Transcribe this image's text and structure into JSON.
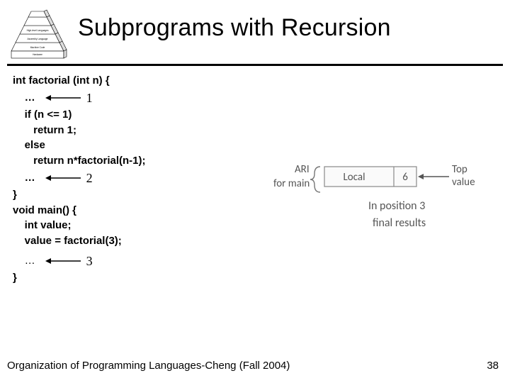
{
  "slide": {
    "title": "Subprograms with Recursion",
    "footer": "Organization of Programming Languages-Cheng (Fall 2004)",
    "page_number": "38"
  },
  "code": {
    "lines": [
      "int factorial (int n) {",
      "    …",
      "    if (n <= 1)",
      "       return 1;",
      "    else",
      "       return n*factorial(n-1);",
      "    …",
      "}",
      "void main() {",
      "    int value;",
      "    value = factorial(3);",
      "    …",
      "}"
    ],
    "annotations": {
      "a1": "1",
      "a2": "2",
      "a3": "3"
    }
  },
  "diagram": {
    "ari_label": "ARI",
    "for_main": "for main",
    "local_label": "Local",
    "local_value": "6",
    "top_label": "Top",
    "value_label": "value",
    "caption1": "In position 3",
    "caption2": "final results"
  },
  "pyramid": {
    "levels": [
      "",
      "High-level Languages",
      "Assembly Language",
      "Machine Code",
      "Hardware"
    ]
  }
}
